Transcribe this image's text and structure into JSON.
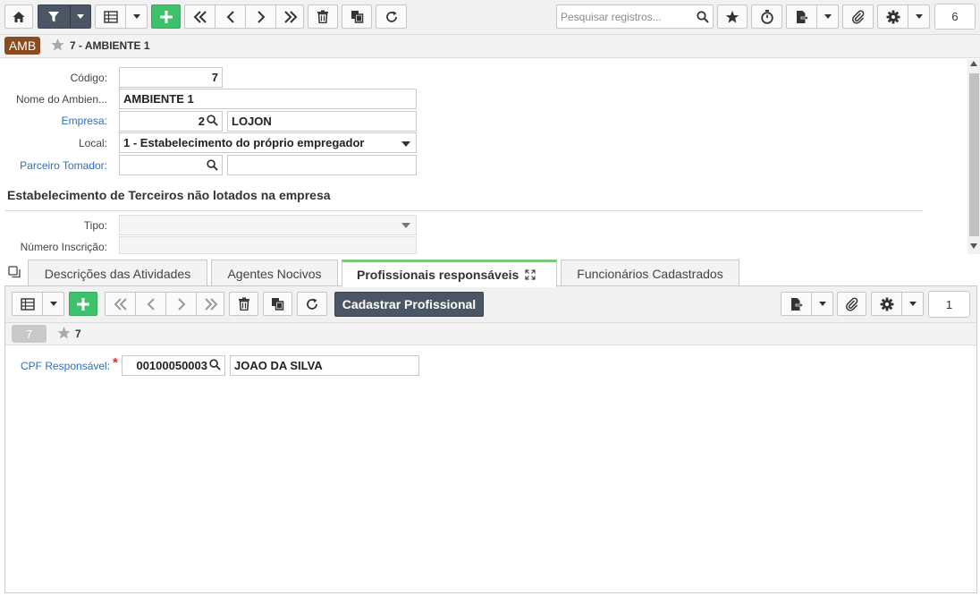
{
  "toolbar": {
    "search_placeholder": "Pesquisar registros...",
    "record_count": "6"
  },
  "header": {
    "badge": "AMB",
    "record_title": "7 - AMBIENTE 1"
  },
  "form": {
    "codigo_label": "Código:",
    "codigo_value": "7",
    "nome_label": "Nome do Ambien...",
    "nome_value": "AMBIENTE 1",
    "empresa_label": "Empresa:",
    "empresa_code": "2",
    "empresa_name": "LOJON",
    "local_label": "Local:",
    "local_value": "1 - Estabelecimento do próprio empregador",
    "parceiro_label": "Parceiro Tomador:",
    "parceiro_code": "",
    "parceiro_name": "",
    "section_title": "Estabelecimento de Terceiros não lotados na empresa",
    "tipo_label": "Tipo:",
    "tipo_value": "",
    "inscricao_label": "Número Inscrição:",
    "inscricao_value": ""
  },
  "tabs": [
    {
      "label": "Descrições das Atividades"
    },
    {
      "label": "Agentes Nocivos"
    },
    {
      "label": "Profissionais responsáveis"
    },
    {
      "label": "Funcionários Cadastrados"
    }
  ],
  "subtoolbar": {
    "cadastrar_label": "Cadastrar Profissional",
    "record_count": "1"
  },
  "subheader": {
    "badge": "7",
    "record_title": "7"
  },
  "subform": {
    "cpf_label": "CPF Responsável:",
    "required_mark": "*",
    "cpf_value": "00100050003",
    "cpf_name": "JOAO DA SILVA"
  },
  "colors": {
    "accent_dark": "#4a5663",
    "add_green": "#3ec16b",
    "link_blue": "#2a70c2",
    "badge_brown": "#8b4a1f",
    "active_tab_bar": "#7cc67e"
  }
}
